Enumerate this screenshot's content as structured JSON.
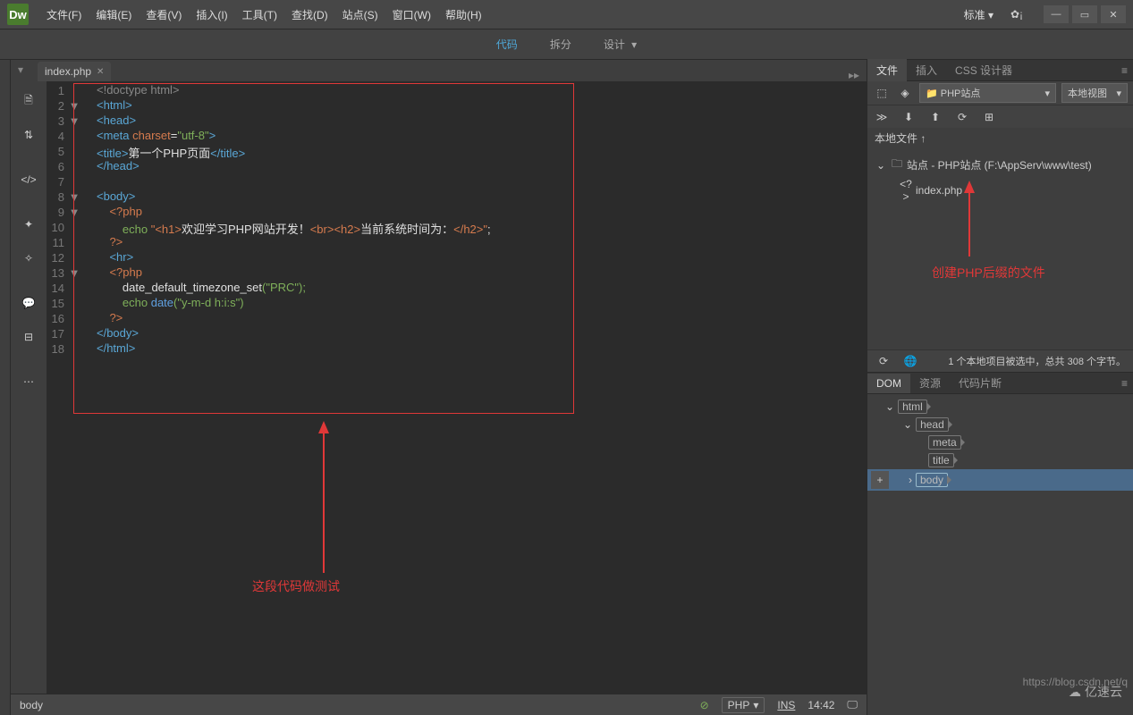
{
  "logo": "Dw",
  "menu": [
    "文件(F)",
    "编辑(E)",
    "查看(V)",
    "插入(I)",
    "工具(T)",
    "查找(D)",
    "站点(S)",
    "窗口(W)",
    "帮助(H)"
  ],
  "layout_label": "标准",
  "view_tabs": {
    "code": "代码",
    "split": "拆分",
    "design": "设计"
  },
  "file_tab": "index.php",
  "code": {
    "l1": "<!doctype html>",
    "l2_open": "<",
    "l2_tag": "html",
    "l2_close": ">",
    "l3_open": "<",
    "l3_tag": "head",
    "l3_close": ">",
    "l4_open": "<",
    "l4_tag": "meta ",
    "l4_attr": "charset",
    "l4_eq": "=",
    "l4_val": "\"utf-8\"",
    "l4_close": ">",
    "l5_open": "<",
    "l5_tag": "title",
    "l5_close": ">",
    "l5_text": "第一个PHP页面",
    "l5_end": "</title>",
    "l6": "</head>",
    "l8_open": "<",
    "l8_tag": "body",
    "l8_close": ">",
    "l9": "<?php",
    "l10_kw": "echo ",
    "l10_s1": "\"<h1>",
    "l10_t1": "欢迎学习PHP网站开发！",
    "l10_s2": "<br><h2>",
    "l10_t2": "当前系统时间为：",
    "l10_s3": "</h2>\"",
    "l10_semi": ";",
    "l11": "?>",
    "l12_open": "<",
    "l12_tag": "hr",
    "l12_close": ">",
    "l13": "<?php",
    "l14_fn": "date_default_timezone_set",
    "l14_arg": "(\"PRC\");",
    "l15_kw": "echo ",
    "l15_fn": "date",
    "l15_arg": "(\"y-m-d h:i:s\")",
    "l16": "?>",
    "l17": "</body>",
    "l18": "</html>"
  },
  "annotations": {
    "code_test": "这段代码做测试",
    "create_php": "创建PHP后缀的文件"
  },
  "status": {
    "breadcrumb": "body",
    "lang": "PHP",
    "ins": "INS",
    "time": "14:42"
  },
  "panels": {
    "files_tab": "文件",
    "insert_tab": "插入",
    "css_tab": "CSS 设计器",
    "site_select": "PHP站点",
    "view_select": "本地视图",
    "local_files": "本地文件 ↑",
    "site_root": "站点 - PHP站点 (F:\\AppServ\\www\\test)",
    "index_file": "index.php",
    "footer_status": "1 个本地项目被选中，总共 308 个字节。",
    "dom_tab": "DOM",
    "res_tab": "资源",
    "snip_tab": "代码片断",
    "dom": {
      "html": "html",
      "head": "head",
      "meta": "meta",
      "title": "title",
      "body": "body"
    }
  },
  "watermark": "https://blog.csdn.net/q",
  "yisu": "亿速云"
}
